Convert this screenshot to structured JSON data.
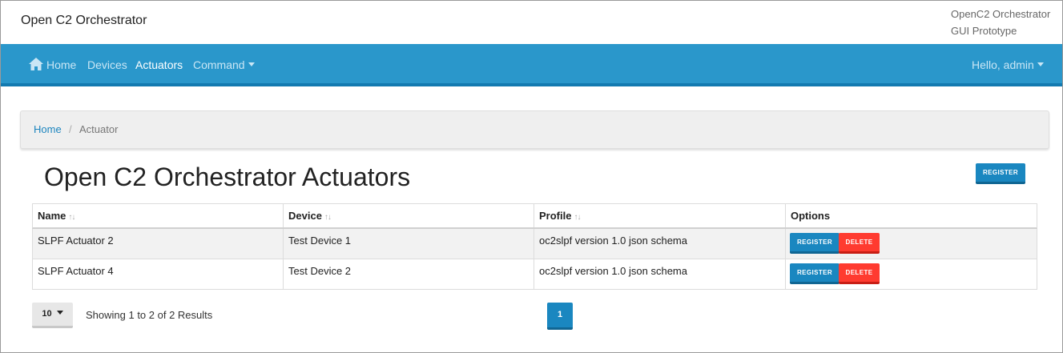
{
  "header": {
    "title": "Open C2 Orchestrator",
    "subtitle_line1": "OpenC2 Orchestrator",
    "subtitle_line2": "GUI Prototype"
  },
  "nav": {
    "home": "Home",
    "devices": "Devices",
    "actuators": "Actuators",
    "command": "Command",
    "user": "Hello, admin"
  },
  "breadcrumb": {
    "home": "Home",
    "separator": "/",
    "current": "Actuator"
  },
  "page": {
    "heading": "Open C2 Orchestrator Actuators",
    "register_label": "REGISTER"
  },
  "table": {
    "headers": [
      "Name",
      "Device",
      "Profile",
      "Options"
    ],
    "sort_glyph": "↑↓",
    "rows": [
      {
        "name": "SLPF Actuator 2",
        "device": "Test Device 1",
        "profile": "oc2slpf version 1.0 json schema",
        "register": "REGISTER",
        "delete": "DELETE"
      },
      {
        "name": "SLPF Actuator 4",
        "device": "Test Device 2",
        "profile": "oc2slpf version 1.0 json schema",
        "register": "REGISTER",
        "delete": "DELETE"
      }
    ]
  },
  "pagination": {
    "page_size": "10",
    "showing": "Showing 1 to 2 of 2 Results",
    "current_page": "1"
  },
  "colors": {
    "navbar": "#2a97cb",
    "primary_button": "#1a87c0",
    "delete_button": "#ff3b30"
  },
  "icons": {
    "home": "home-icon",
    "dropdown": "caret-down-icon",
    "sort": "sort-icon"
  }
}
